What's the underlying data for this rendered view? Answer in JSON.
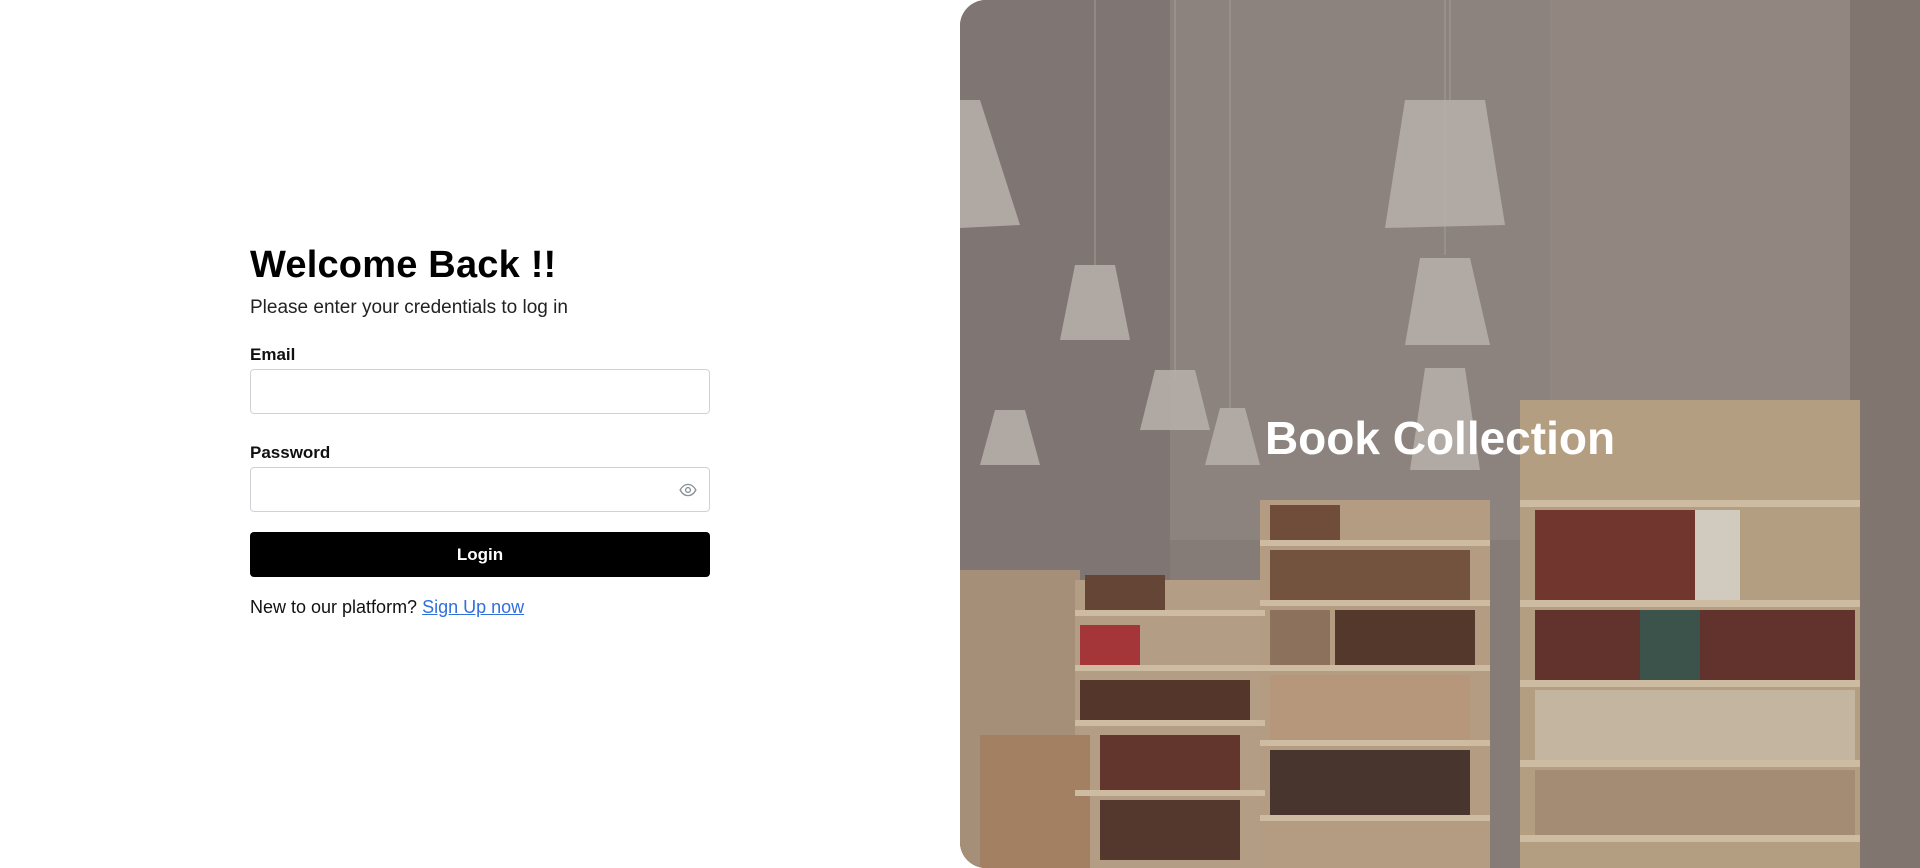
{
  "login": {
    "title": "Welcome Back !!",
    "subtitle": "Please enter your credentials to log in",
    "email_label": "Email",
    "email_value": "",
    "password_label": "Password",
    "password_value": "",
    "password_toggle_icon": "eye-icon",
    "login_button": "Login",
    "signup_prompt": "New to our platform?",
    "signup_link": "Sign Up now"
  },
  "hero": {
    "title": "Book Collection",
    "image": "bookstore-interior-photo"
  },
  "colors": {
    "button_bg": "#000000",
    "link": "#2f6fde",
    "input_border": "#cfd3d8"
  }
}
